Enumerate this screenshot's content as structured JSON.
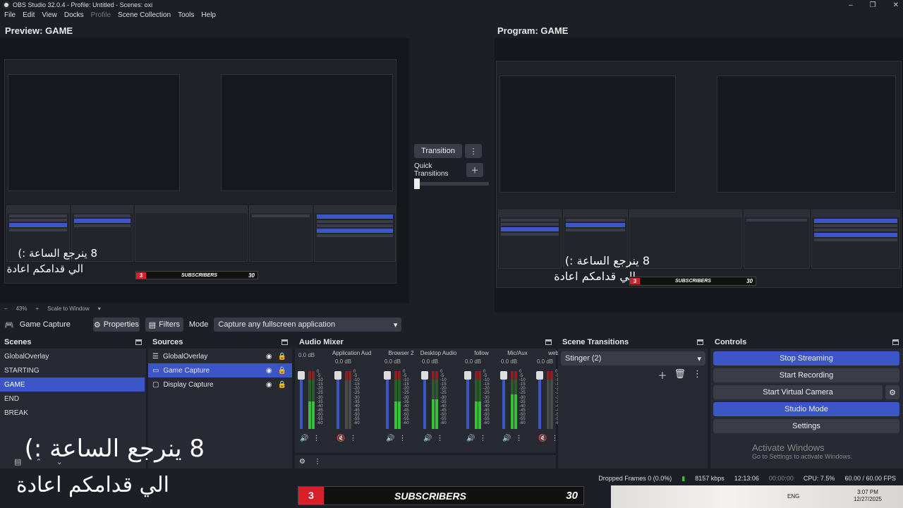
{
  "window": {
    "title": "OBS Studio 32.0.4 - Profile: Untitled - Scenes: oxi",
    "controls": [
      "–",
      "❐",
      "✕"
    ]
  },
  "menu": [
    "File",
    "Edit",
    "View",
    "Docks",
    "Profile",
    "Scene Collection",
    "Tools",
    "Help"
  ],
  "preview": {
    "label": "Preview: GAME",
    "zoom": "43%",
    "scale_mode": "Scale to Window"
  },
  "program": {
    "label": "Program: GAME"
  },
  "transition": {
    "button": "Transition",
    "quick_label": "Quick Transitions"
  },
  "source_bar": {
    "source_name": "Game Capture",
    "properties": "Properties",
    "filters": "Filters",
    "mode_label": "Mode",
    "mode_value": "Capture any fullscreen application"
  },
  "scenes": {
    "title": "Scenes",
    "items": [
      "GlobalOverlay",
      "STARTING",
      "GAME",
      "END",
      "BREAK"
    ],
    "active_index": 2
  },
  "sources": {
    "title": "Sources",
    "items": [
      "GlobalOverlay",
      "Game Capture",
      "Display Capture"
    ],
    "active_index": 1
  },
  "mixer": {
    "title": "Audio Mixer",
    "channels": [
      {
        "name": "",
        "db": "0.0 dB",
        "level": 0.55,
        "muted": false
      },
      {
        "name": "Application Audio C",
        "db": "0.0 dB",
        "level": 0.0,
        "muted": true
      },
      {
        "name": "Browser 2",
        "db": "0.0 dB",
        "level": 0.55,
        "muted": false
      },
      {
        "name": "Desktop Audio",
        "db": "0.0 dB",
        "level": 0.6,
        "muted": false
      },
      {
        "name": "follow",
        "db": "0.0 dB",
        "level": 0.55,
        "muted": false
      },
      {
        "name": "Mic/Aux",
        "db": "0.0 dB",
        "level": 0.7,
        "muted": false
      },
      {
        "name": "web",
        "db": "0.0 dB",
        "level": 0.0,
        "muted": true
      }
    ],
    "scale": [
      "0",
      "-5",
      "-10",
      "-15",
      "-20",
      "-25",
      "-30",
      "-35",
      "-40",
      "-45",
      "-50",
      "-55",
      "-60"
    ]
  },
  "scene_transitions": {
    "title": "Scene Transitions",
    "selected": "Stinger (2)"
  },
  "controls": {
    "title": "Controls",
    "stop_streaming": "Stop Streaming",
    "start_recording": "Start Recording",
    "start_virtual_camera": "Start Virtual Camera",
    "studio_mode": "Studio Mode",
    "settings": "Settings"
  },
  "activate_windows": {
    "line1": "Activate Windows",
    "line2": "Go to Settings to activate Windows."
  },
  "status": {
    "dropped_frames": "Dropped Frames 0 (0.0%)",
    "kbps": "8157 kbps",
    "stream_time": "12:13:06",
    "rec_time": "00:00:00",
    "cpu": "CPU: 7.5%",
    "fps": "60.00 / 60.00 FPS"
  },
  "overlay": {
    "line1": "8 ينرجع الساعة :)",
    "line2": "الي قدامكم اعادة",
    "sub_number": "3",
    "sub_word": "SUBSCRIBERS",
    "sub_count": "30"
  },
  "taskbar": {
    "lang": "ENG",
    "time": "3:07 PM",
    "date": "12/27/2025"
  },
  "colors": {
    "accent": "#3c56c8",
    "bg": "#1d1f26",
    "panel": "#272a33",
    "button": "#3a3d48"
  }
}
